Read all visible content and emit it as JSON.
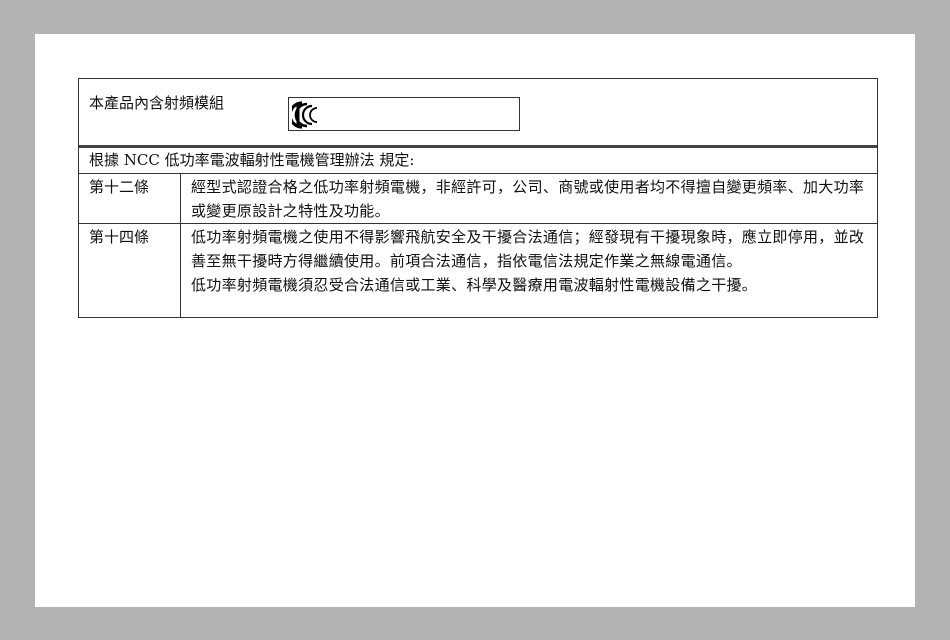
{
  "module_label": "本產品內含射頻模組",
  "statement": "根據 NCC 低功率電波輻射性電機管理辦法  規定:",
  "articles": [
    {
      "title": "第十二條",
      "lines": [
        "經型式認證合格之低功率射頻電機，非經許可，公司、商號或使用者均不得擅自變更頻率、加大功率或變更原設計之特性及功能。"
      ]
    },
    {
      "title": "第十四條",
      "lines": [
        "低功率射頻電機之使用不得影響飛航安全及干擾合法通信；經發現有干擾現象時，應立即停用，並改善至無干擾時方得繼續使用。前項合法通信，指依電信法規定作業之無線電通信。",
        "低功率射頻電機須忍受合法通信或工業、科學及醫療用電波輻射性電機設備之干擾。"
      ]
    }
  ],
  "icons": {
    "mark": "ncc-mark-icon"
  }
}
